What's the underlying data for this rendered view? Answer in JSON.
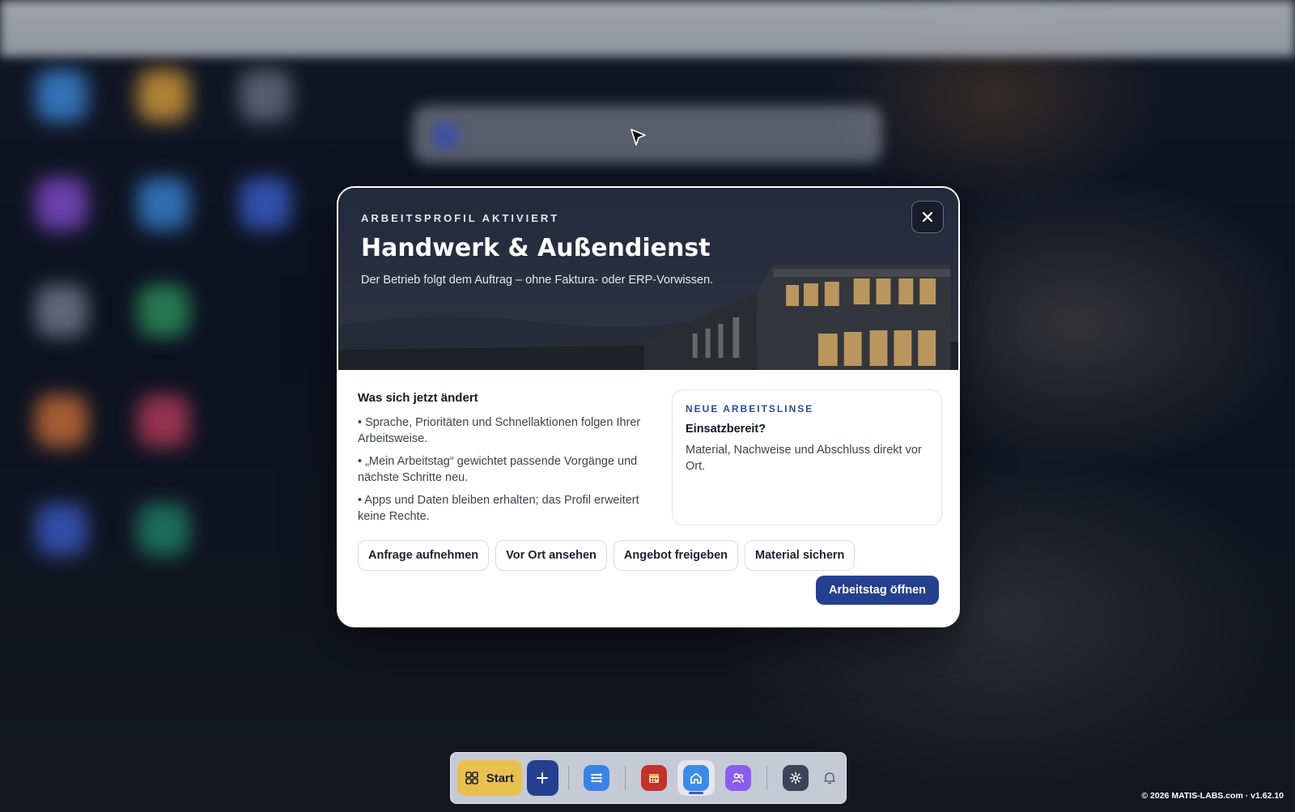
{
  "modal": {
    "eyebrow": "ARBEITSPROFIL AKTIVIERT",
    "title": "Handwerk & Außendienst",
    "subtitle": "Der Betrieb folgt dem Auftrag – ohne Faktura- oder ERP-Vorwissen.",
    "close_icon": "close-icon",
    "changes": {
      "heading": "Was sich jetzt ändert",
      "items": [
        "• Sprache, Prioritäten und Schnellaktionen folgen Ihrer Arbeitsweise.",
        "• „Mein Arbeitstag“ gewichtet passende Vorgänge und nächste Schritte neu.",
        "• Apps und Daten bleiben erhalten; das Profil erweitert keine Rechte."
      ]
    },
    "lens": {
      "eyebrow": "NEUE ARBEITSLINSE",
      "title": "Einsatzbereit?",
      "text": "Material, Nachweise und Abschluss direkt vor Ort."
    },
    "chips": [
      "Anfrage aufnehmen",
      "Vor Ort ansehen",
      "Angebot freigeben",
      "Material sichern"
    ],
    "primary_label": "Arbeitstag öffnen"
  },
  "dock": {
    "start_label": "Start",
    "apps": [
      {
        "icon": "grid-icon"
      },
      {
        "icon": "plus-icon"
      },
      {
        "icon": "workflow-icon"
      },
      {
        "icon": "calendar-icon",
        "badge": "ML"
      },
      {
        "icon": "home-icon",
        "active": true
      },
      {
        "icon": "users-icon"
      },
      {
        "icon": "gear-icon"
      },
      {
        "icon": "bell-icon"
      }
    ]
  },
  "footer": {
    "text": "© 2026 MATIS-LABS.com · v1.62.10"
  },
  "colors": {
    "accent": "#24408f",
    "start": "#e8c04f"
  }
}
